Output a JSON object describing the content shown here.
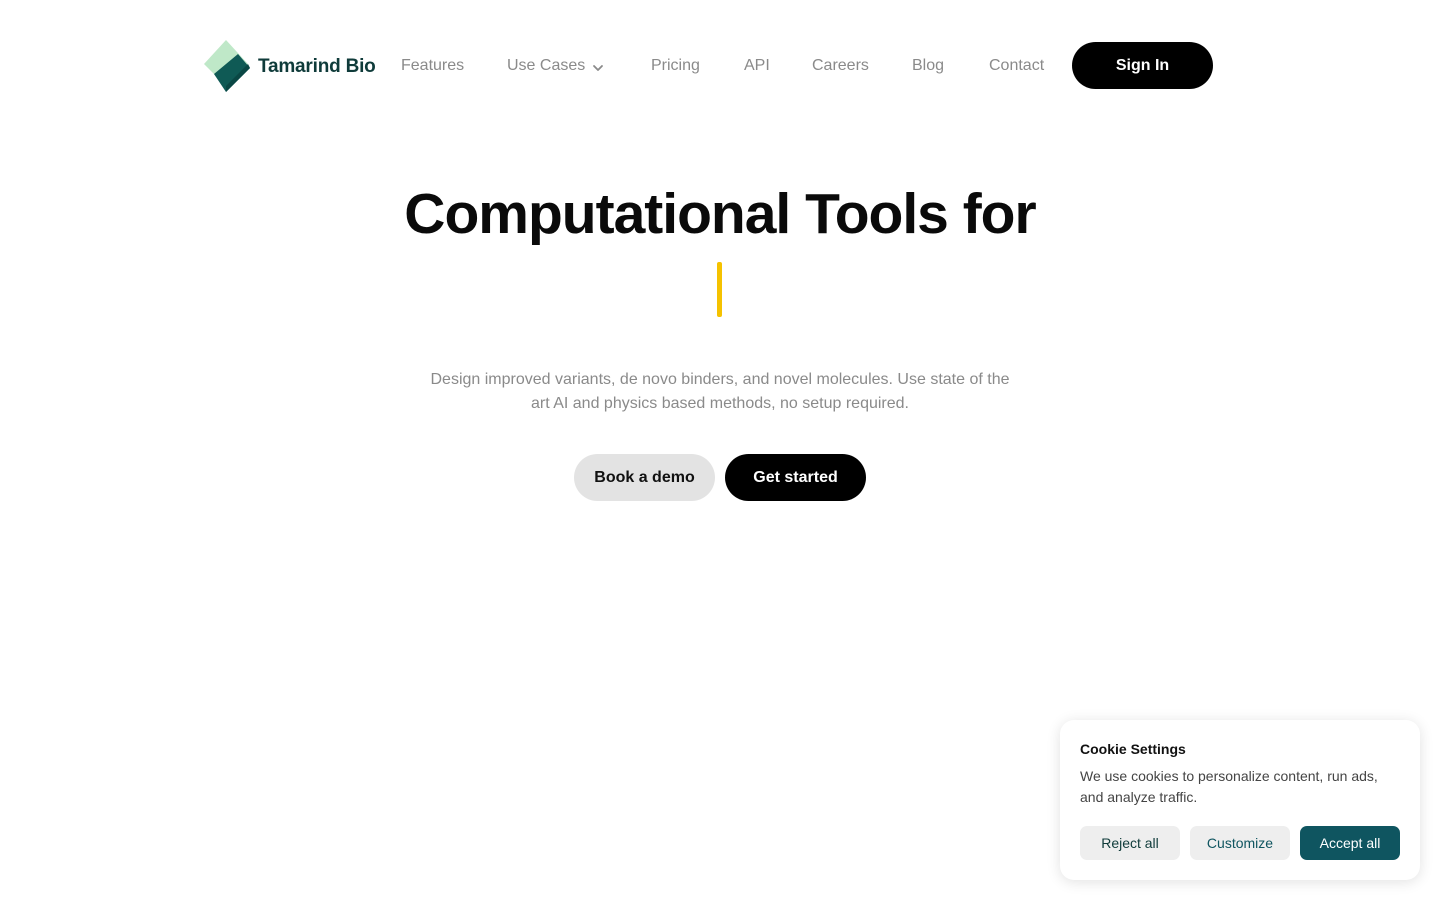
{
  "brand": {
    "name": "Tamarind Bio",
    "text_color": "#0f3b3a",
    "mark_colors": [
      "#bfe8c8",
      "#0f5a55"
    ]
  },
  "nav": {
    "items": [
      {
        "label": "Features"
      },
      {
        "label": "Use Cases",
        "has_dropdown": true
      },
      {
        "label": "Pricing"
      },
      {
        "label": "API"
      },
      {
        "label": "Careers"
      },
      {
        "label": "Blog"
      },
      {
        "label": "Contact"
      }
    ],
    "signin_label": "Sign In"
  },
  "hero": {
    "title": "Computational Tools for",
    "cursor_color": "#f5c200",
    "subtitle": "Design improved variants, de novo binders, and novel molecules. Use state of the art AI and physics based methods, no setup required.",
    "demo_label": "Book a demo",
    "start_label": "Get started"
  },
  "cookie": {
    "title": "Cookie Settings",
    "text": "We use cookies to personalize content, run ads, and analyze traffic.",
    "reject_label": "Reject all",
    "customize_label": "Customize",
    "accept_label": "Accept all",
    "accent_color": "#0f5560"
  }
}
